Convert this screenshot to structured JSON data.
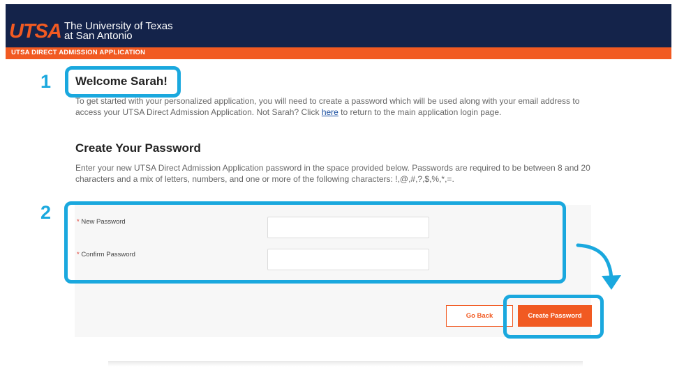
{
  "header": {
    "logo": "UTSA",
    "university_line1": "The University of Texas",
    "university_line2": "at San Antonio",
    "bar_title": "UTSA DIRECT ADMISSION APPLICATION"
  },
  "welcome": {
    "heading": "Welcome Sarah!",
    "intro_before_link": "To get started with your personalized application, you will need to create a password which will be used along with your email address to access your UTSA Direct Admission Application. Not Sarah? Click ",
    "link_text": "here",
    "intro_after_link": " to return to the main application login page."
  },
  "password_section": {
    "heading": "Create Your Password",
    "description": "Enter your new UTSA Direct Admission Application password in the space provided below. Passwords are required to be between 8 and 20 characters and a mix of letters, numbers, and one or more of the following characters: !,@,#,?,$,%,*,=."
  },
  "form": {
    "required_marker": "*",
    "new_password_label": "New Password",
    "new_password_value": "",
    "confirm_password_label": "Confirm Password",
    "confirm_password_value": "",
    "go_back_label": "Go Back",
    "create_label": "Create Password"
  },
  "annotations": {
    "step1": "1",
    "step2": "2",
    "color": "#1aa8de"
  },
  "colors": {
    "navy": "#14234a",
    "orange": "#f15a22"
  }
}
